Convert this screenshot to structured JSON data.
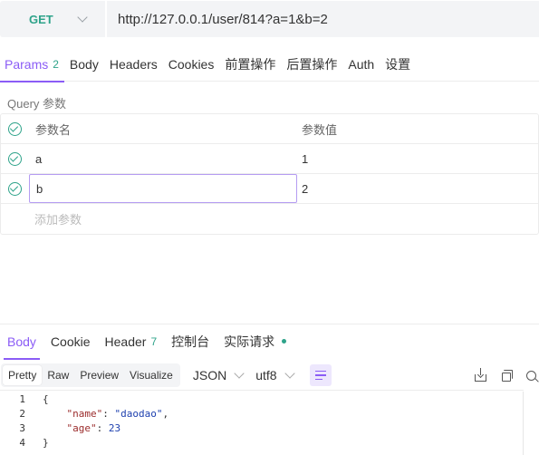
{
  "request": {
    "method": "GET",
    "url": "http://127.0.0.1/user/814?a=1&b=2"
  },
  "request_tabs": [
    {
      "label": "Params",
      "badge": "2",
      "active": true
    },
    {
      "label": "Body"
    },
    {
      "label": "Headers"
    },
    {
      "label": "Cookies"
    },
    {
      "label": "前置操作"
    },
    {
      "label": "后置操作"
    },
    {
      "label": "Auth"
    },
    {
      "label": "设置"
    }
  ],
  "query": {
    "title": "Query 参数",
    "col_name": "参数名",
    "col_value": "参数值",
    "rows": [
      {
        "name": "a",
        "value": "1",
        "enabled": true
      },
      {
        "name": "b",
        "value": "2",
        "enabled": true
      }
    ],
    "add_placeholder": "添加参数"
  },
  "response_tabs": [
    {
      "label": "Body",
      "active": true
    },
    {
      "label": "Cookie"
    },
    {
      "label": "Header",
      "badge": "7"
    },
    {
      "label": "控制台"
    },
    {
      "label": "实际请求"
    }
  ],
  "format_bar": {
    "modes": [
      "Pretty",
      "Raw",
      "Preview",
      "Visualize"
    ],
    "active_mode": "Pretty",
    "type": "JSON",
    "encoding": "utf8"
  },
  "editor": {
    "line_numbers": [
      "1",
      "2",
      "3",
      "4"
    ],
    "open_brace": "{",
    "close_brace": "}",
    "name_key": "\"name\"",
    "name_value": "\"daodao\"",
    "age_key": "\"age\"",
    "age_value": "23"
  },
  "colors": {
    "accent": "#8b5cf6",
    "method_get": "#2ea38a",
    "check": "#2ea38a"
  }
}
